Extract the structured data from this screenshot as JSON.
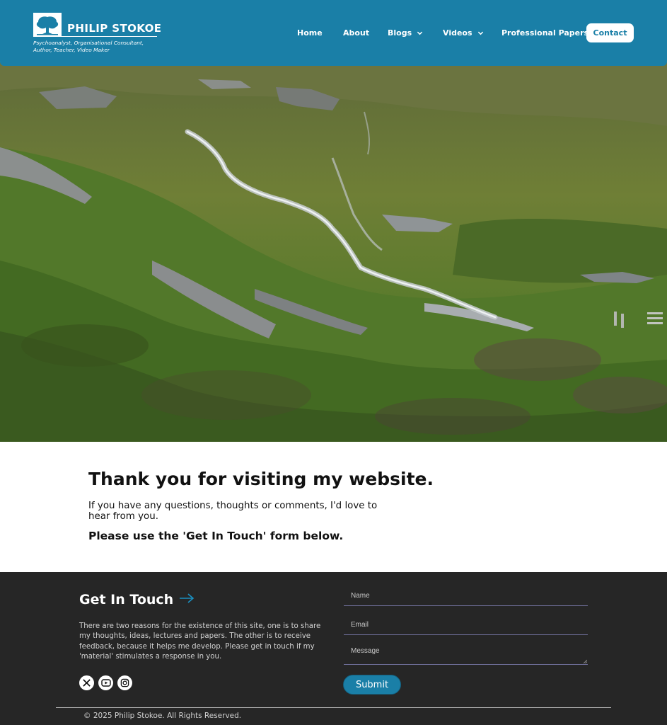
{
  "header": {
    "logo_name": "PHILIP STOKOE",
    "logo_tagline": "Psychoanalyst, Organisational Consultant, Author, Teacher, Video Maker",
    "logo_icon": "tree-icon",
    "background_color": "#1a7fa7"
  },
  "nav": {
    "items": [
      {
        "label": "Home",
        "has_dropdown": false
      },
      {
        "label": "About",
        "has_dropdown": false
      },
      {
        "label": "Blogs",
        "has_dropdown": true
      },
      {
        "label": "Videos",
        "has_dropdown": true
      },
      {
        "label": "Professional Papers",
        "has_dropdown": false
      }
    ],
    "contact_label": "Contact"
  },
  "hero": {
    "image_subject": "moorland-stream-photo"
  },
  "intro": {
    "title": "Thank you for visiting my website.",
    "body": "If you have any questions, thoughts or comments, I'd love to hear from you.",
    "cta": "Please use the 'Get In Touch' form below."
  },
  "footer": {
    "background_color": "#262626",
    "get_in_touch_title": "Get In Touch",
    "description": "There are two reasons for the existence of this site, one is to share my thoughts, ideas, lectures and papers. The other is to receive feedback, because it helps me develop. Please get in touch if my 'material' stimulates a response in you.",
    "social_icons": [
      "x-icon",
      "youtube-icon",
      "instagram-icon"
    ],
    "form": {
      "name_placeholder": "Name",
      "email_placeholder": "Email",
      "message_placeholder": "Message",
      "submit_label": "Submit"
    },
    "copyright": "© 2025 Philip Stokoe. All Rights Reserved."
  }
}
